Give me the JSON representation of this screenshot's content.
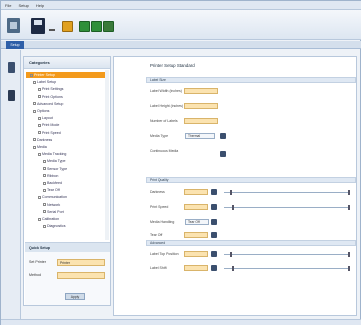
{
  "menu": [
    "File",
    "Setup",
    "Help"
  ],
  "tab": {
    "label": "Setup"
  },
  "categories": {
    "title": "Categories",
    "items": [
      {
        "label": "Printer Setup",
        "selected": true,
        "indent": 1
      },
      {
        "label": "Label Setup",
        "indent": 1
      },
      {
        "label": "Print Settings",
        "indent": 2
      },
      {
        "label": "Print Options",
        "indent": 2
      },
      {
        "label": "Advanced Setup",
        "indent": 1
      },
      {
        "label": "Options",
        "indent": 1
      },
      {
        "label": "Layout",
        "indent": 2
      },
      {
        "label": "Print Mode",
        "indent": 2
      },
      {
        "label": "Print Speed",
        "indent": 2
      },
      {
        "label": "Darkness",
        "indent": 1
      },
      {
        "label": "Media",
        "indent": 1
      },
      {
        "label": "Media Tracking",
        "indent": 2
      },
      {
        "label": "Media Type",
        "indent": 3
      },
      {
        "label": "Sensor Type",
        "indent": 3
      },
      {
        "label": "Ribbon",
        "indent": 3
      },
      {
        "label": "Backfeed",
        "indent": 3
      },
      {
        "label": "Tear Off",
        "indent": 3
      },
      {
        "label": "Communication",
        "indent": 2
      },
      {
        "label": "Network",
        "indent": 3
      },
      {
        "label": "Serial Port",
        "indent": 3
      },
      {
        "label": "Calibration",
        "indent": 2
      },
      {
        "label": "Diagnostics",
        "indent": 3
      }
    ]
  },
  "search": {
    "title": "Quick Setup",
    "row1_label": "Set Printer",
    "row1_value": "Printer",
    "row2_label": "Method",
    "button": "Apply"
  },
  "main": {
    "title": "Printer Setup Standard",
    "sections": [
      {
        "header": "Label Size",
        "fields": [
          {
            "label": "Label Width (inches)",
            "value": ""
          },
          {
            "label": "Label Height (inches)",
            "value": ""
          },
          {
            "label": "Number of Labels",
            "value": ""
          },
          {
            "label": "Media Type",
            "value": "Thermal"
          },
          {
            "label": "Continuous Media",
            "value": ""
          }
        ]
      },
      {
        "header": "Print Quality",
        "fields": [
          {
            "label": "Darkness",
            "value": ""
          },
          {
            "label": "Print Speed",
            "value": ""
          },
          {
            "label": "Media Handling",
            "value": "Tear Off"
          },
          {
            "label": "Tear Off",
            "value": ""
          }
        ]
      },
      {
        "header": "Advanced",
        "fields": [
          {
            "label": "Label Top Position",
            "value": ""
          },
          {
            "label": "Label Shift",
            "value": ""
          }
        ]
      }
    ]
  }
}
